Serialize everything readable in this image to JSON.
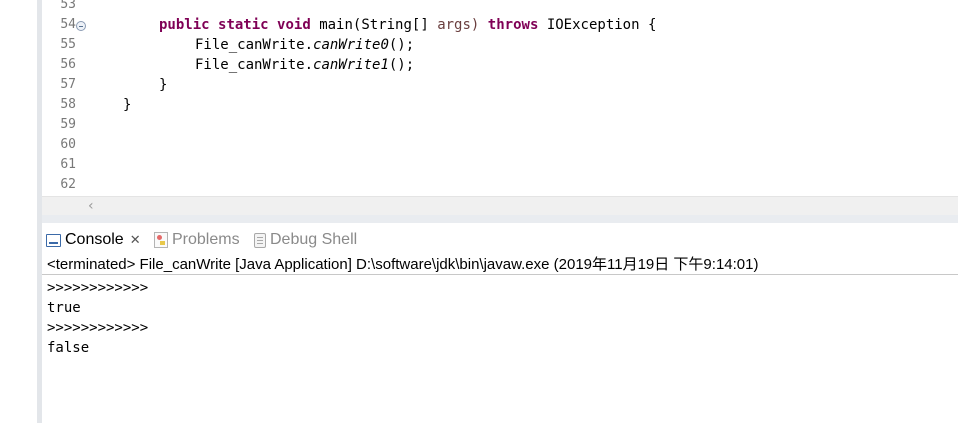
{
  "editor": {
    "line_numbers": [
      "53",
      "54",
      "55",
      "56",
      "57",
      "58",
      "59",
      "60",
      "61",
      "62"
    ],
    "code": {
      "line54": {
        "kw_public": "public",
        "kw_static": "static",
        "kw_void": "void",
        "method_sig": "main(String[]",
        "param": "args)",
        "kw_throws": "throws",
        "exception": "IOException {"
      },
      "line55": {
        "receiver": "File_canWrite.",
        "method": "canWrite0",
        "tail": "();"
      },
      "line56": {
        "receiver": "File_canWrite.",
        "method": "canWrite1",
        "tail": "();"
      },
      "line57": "}",
      "line58": "}"
    }
  },
  "console": {
    "tabs": {
      "console": "Console",
      "problems": "Problems",
      "debug_shell": "Debug Shell"
    },
    "status": "<terminated> File_canWrite [Java Application] D:\\software\\jdk\\bin\\javaw.exe (2019年11月19日 下午9:14:01)",
    "output": [
      ">>>>>>>>>>>>",
      "true",
      ">>>>>>>>>>>>",
      "false"
    ]
  },
  "colors": {
    "keyword": "#7f0055",
    "parameter": "#6a3e3e",
    "line_number": "#787878"
  }
}
